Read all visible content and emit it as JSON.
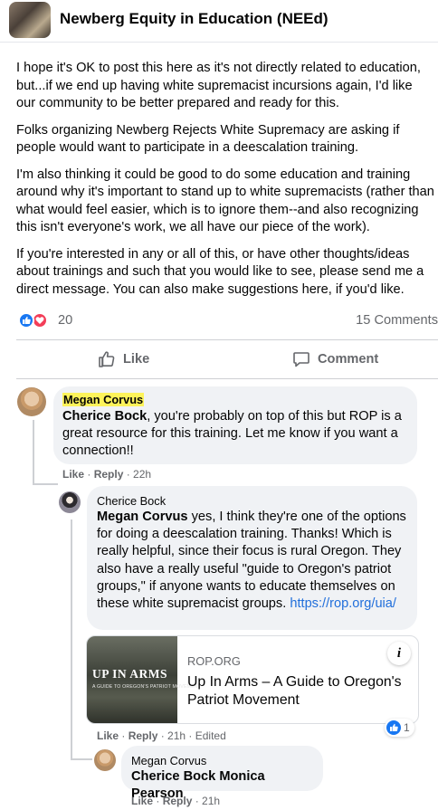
{
  "header": {
    "group_name": "Newberg Equity in Education (NEEd)"
  },
  "post": {
    "paragraphs": [
      "I hope it's OK to post this here as it's not directly related to education, but...if we end up having white supremacist incursions again, I'd like our community to be better prepared and ready for this.",
      "Folks organizing Newberg Rejects White Supremacy are asking if people would want to participate in a deescalation training.",
      "I'm also thinking it could be good to do some education and training around why it's important to stand up to white supremacists (rather than what would feel easier, which is to ignore them--and also recognizing this isn't everyone's work, we all have our piece of the work).",
      "If you're interested in any or all of this, or have other thoughts/ideas about trainings and such that you would like to see, please send me a direct message. You can also make suggestions here, if you'd like."
    ],
    "reaction_count": "20",
    "comment_count": "15 Comments",
    "like_label": "Like",
    "comment_label": "Comment"
  },
  "comments": {
    "c1": {
      "author": "Megan Corvus",
      "mention": "Cherice Bock",
      "text": ", you're probably on top of this but ROP is a great resource for this training. Let me know if you want a connection!!",
      "like": "Like",
      "reply": "Reply",
      "time": "22h"
    },
    "c2": {
      "author": "Cherice Bock",
      "mention": "Megan Corvus",
      "text": " yes, I think they're one of the options for doing a deescalation training. Thanks! Which is really helpful, since their focus is rural Oregon. They also have a really useful \"guide to Oregon's patriot groups,\" if anyone wants to educate themselves on these white supremacist groups. ",
      "link": "https://rop.org/uia/",
      "like": "Like",
      "reply": "Reply",
      "time": "21h",
      "edited": "Edited",
      "reaction_count": "1",
      "card": {
        "image_title": "UP IN ARMS",
        "image_subtitle": "A GUIDE TO OREGON'S PATRIOT MOVEMENT",
        "domain": "ROP.ORG",
        "title": "Up In Arms – A Guide to Oregon's Patriot Movement"
      }
    },
    "c3": {
      "author": "Megan Corvus",
      "mention1": "Cherice Bock",
      "mention2": "Monica Pearson",
      "like": "Like",
      "reply": "Reply",
      "time": "21h"
    }
  },
  "colors": {
    "accent": "#1877f2",
    "link": "#216fdb",
    "heart": "#f33e58",
    "highlight": "#fdf35a",
    "bubble": "#f0f2f5"
  }
}
